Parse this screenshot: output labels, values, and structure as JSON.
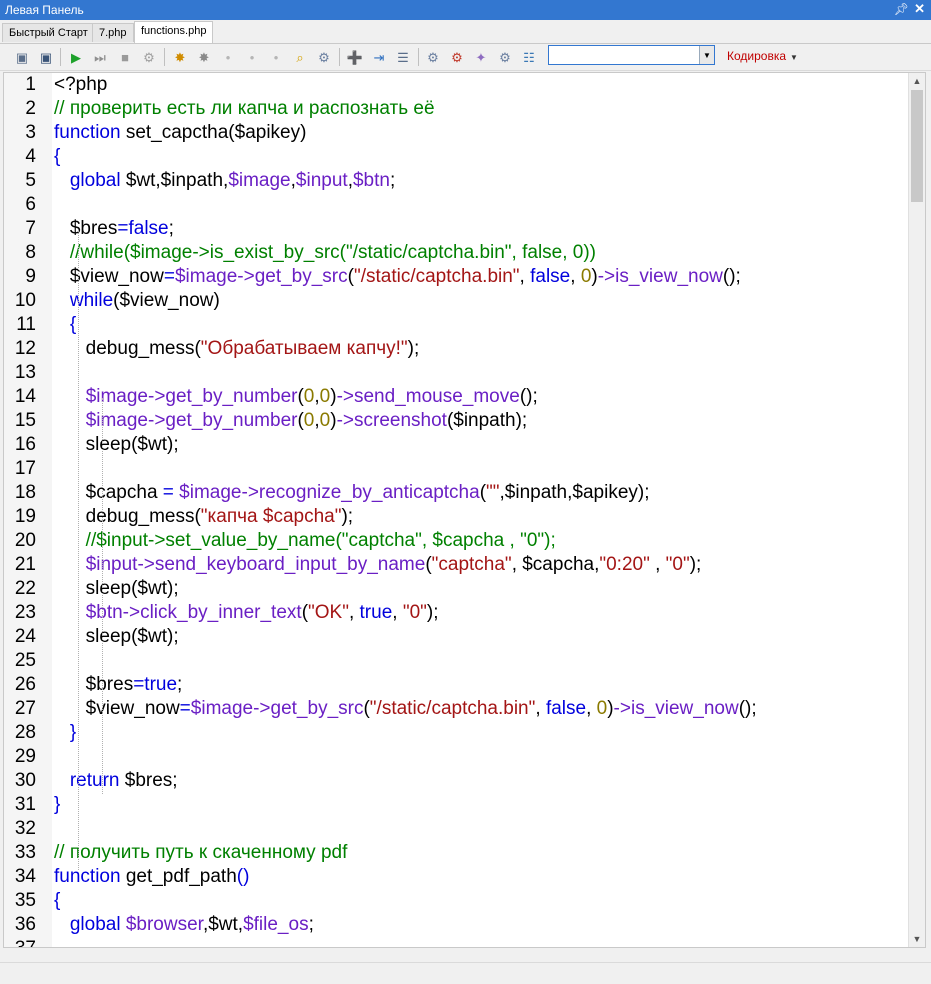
{
  "panel": {
    "title": "Левая Панель",
    "pin_icon": "pin-icon",
    "close_icon": "close-icon"
  },
  "tabs": [
    {
      "label": "Быстрый Старт",
      "active": false
    },
    {
      "label": "7.php",
      "active": false
    },
    {
      "label": "functions.php",
      "active": true
    }
  ],
  "toolbar": {
    "icons": [
      "save-icon",
      "save-all-icon",
      "run-icon",
      "step-icon",
      "stop-icon",
      "settings-icon",
      "debug-icon",
      "bug-icon",
      "record-icon",
      "record-all-icon",
      "record-stop-icon",
      "find-icon",
      "gear-icon",
      "new-file-icon",
      "import-icon",
      "document-icon",
      "plugin-icon",
      "plugin-add-icon",
      "wand-icon",
      "network-icon",
      "tree-icon"
    ],
    "combo_value": "",
    "encoding_label": "Кодировка"
  },
  "editor": {
    "first_line": 1,
    "lines": [
      [
        [
          "<?php",
          "p"
        ]
      ],
      [
        [
          "// проверить есть ли капча и распознать её",
          "c"
        ]
      ],
      [
        [
          "function",
          "k"
        ],
        [
          " set_capctha(",
          "p"
        ],
        [
          "$apikey",
          "p"
        ],
        [
          ")",
          "p"
        ]
      ],
      [
        [
          "{",
          "k"
        ]
      ],
      [
        [
          "   ",
          "p"
        ],
        [
          "global",
          "k"
        ],
        [
          " $wt,$inpath,",
          "p"
        ],
        [
          "$image",
          "v"
        ],
        [
          ",",
          "p"
        ],
        [
          "$input",
          "v"
        ],
        [
          ",",
          "p"
        ],
        [
          "$btn",
          "v"
        ],
        [
          ";",
          "p"
        ]
      ],
      [],
      [
        [
          "   $bres",
          "p"
        ],
        [
          "=false",
          "k"
        ],
        [
          ";",
          "p"
        ]
      ],
      [
        [
          "   //while($image->is_exist_by_src(\"/static/captcha.bin\", false, 0))",
          "c"
        ]
      ],
      [
        [
          "   $view_now",
          "p"
        ],
        [
          "=",
          "k"
        ],
        [
          "$image->get_by_src",
          "v"
        ],
        [
          "(",
          "p"
        ],
        [
          "\"/static/captcha.bin\"",
          "s"
        ],
        [
          ", ",
          "p"
        ],
        [
          "false",
          "k"
        ],
        [
          ", ",
          "p"
        ],
        [
          "0",
          "n"
        ],
        [
          ")",
          "p"
        ],
        [
          "->is_view_now",
          "v"
        ],
        [
          "();",
          "p"
        ]
      ],
      [
        [
          "   ",
          "p"
        ],
        [
          "while",
          "k"
        ],
        [
          "($view_now)",
          "p"
        ]
      ],
      [
        [
          "   {",
          "k"
        ]
      ],
      [
        [
          "      debug_mess(",
          "p"
        ],
        [
          "\"Обрабатываем капчу!\"",
          "s"
        ],
        [
          ");",
          "p"
        ]
      ],
      [],
      [
        [
          "      ",
          "p"
        ],
        [
          "$image->get_by_number",
          "v"
        ],
        [
          "(",
          "p"
        ],
        [
          "0",
          "n"
        ],
        [
          ",",
          "p"
        ],
        [
          "0",
          "n"
        ],
        [
          ")",
          "p"
        ],
        [
          "->send_mouse_move",
          "v"
        ],
        [
          "();",
          "p"
        ]
      ],
      [
        [
          "      ",
          "p"
        ],
        [
          "$image->get_by_number",
          "v"
        ],
        [
          "(",
          "p"
        ],
        [
          "0",
          "n"
        ],
        [
          ",",
          "p"
        ],
        [
          "0",
          "n"
        ],
        [
          ")",
          "p"
        ],
        [
          "->screenshot",
          "v"
        ],
        [
          "($inpath);",
          "p"
        ]
      ],
      [
        [
          "      sleep($wt);",
          "p"
        ]
      ],
      [],
      [
        [
          "      $capcha ",
          "p"
        ],
        [
          "= ",
          "k"
        ],
        [
          "$image->recognize_by_anticaptcha",
          "v"
        ],
        [
          "(",
          "p"
        ],
        [
          "\"\"",
          "s"
        ],
        [
          ",$inpath,$apikey);",
          "p"
        ]
      ],
      [
        [
          "      debug_mess(",
          "p"
        ],
        [
          "\"капча $capcha\"",
          "s"
        ],
        [
          ");",
          "p"
        ]
      ],
      [
        [
          "      //$input->set_value_by_name(\"captcha\", $capcha , \"0\");",
          "c"
        ]
      ],
      [
        [
          "      ",
          "p"
        ],
        [
          "$input->send_keyboard_input_by_name",
          "v"
        ],
        [
          "(",
          "p"
        ],
        [
          "\"captcha\"",
          "s"
        ],
        [
          ", $capcha,",
          "p"
        ],
        [
          "\"0:20\"",
          "s"
        ],
        [
          " , ",
          "p"
        ],
        [
          "\"0\"",
          "s"
        ],
        [
          ");",
          "p"
        ]
      ],
      [
        [
          "      sleep($wt);",
          "p"
        ]
      ],
      [
        [
          "      ",
          "p"
        ],
        [
          "$btn->click_by_inner_text",
          "v"
        ],
        [
          "(",
          "p"
        ],
        [
          "\"OK\"",
          "s"
        ],
        [
          ", ",
          "p"
        ],
        [
          "true",
          "k"
        ],
        [
          ", ",
          "p"
        ],
        [
          "\"0\"",
          "s"
        ],
        [
          ");",
          "p"
        ]
      ],
      [
        [
          "      sleep($wt);",
          "p"
        ]
      ],
      [],
      [
        [
          "      $bres",
          "p"
        ],
        [
          "=true",
          "k"
        ],
        [
          ";",
          "p"
        ]
      ],
      [
        [
          "      $view_now",
          "p"
        ],
        [
          "=",
          "k"
        ],
        [
          "$image->get_by_src",
          "v"
        ],
        [
          "(",
          "p"
        ],
        [
          "\"/static/captcha.bin\"",
          "s"
        ],
        [
          ", ",
          "p"
        ],
        [
          "false",
          "k"
        ],
        [
          ", ",
          "p"
        ],
        [
          "0",
          "n"
        ],
        [
          ")",
          "p"
        ],
        [
          "->is_view_now",
          "v"
        ],
        [
          "();",
          "p"
        ]
      ],
      [
        [
          "   }",
          "k"
        ]
      ],
      [],
      [
        [
          "   ",
          "p"
        ],
        [
          "return",
          "k"
        ],
        [
          " $bres;",
          "p"
        ]
      ],
      [
        [
          "}",
          "k"
        ]
      ],
      [],
      [
        [
          "// получить путь к скаченному pdf",
          "c"
        ]
      ],
      [
        [
          "function",
          "k"
        ],
        [
          " get_pdf_path",
          "p"
        ],
        [
          "()",
          "k"
        ]
      ],
      [
        [
          "{",
          "k"
        ]
      ],
      [
        [
          "   ",
          "p"
        ],
        [
          "global",
          "k"
        ],
        [
          " ",
          "p"
        ],
        [
          "$browser",
          "v"
        ],
        [
          ",$wt,",
          "p"
        ],
        [
          "$file_os",
          "v"
        ],
        [
          ";",
          "p"
        ]
      ],
      []
    ]
  }
}
